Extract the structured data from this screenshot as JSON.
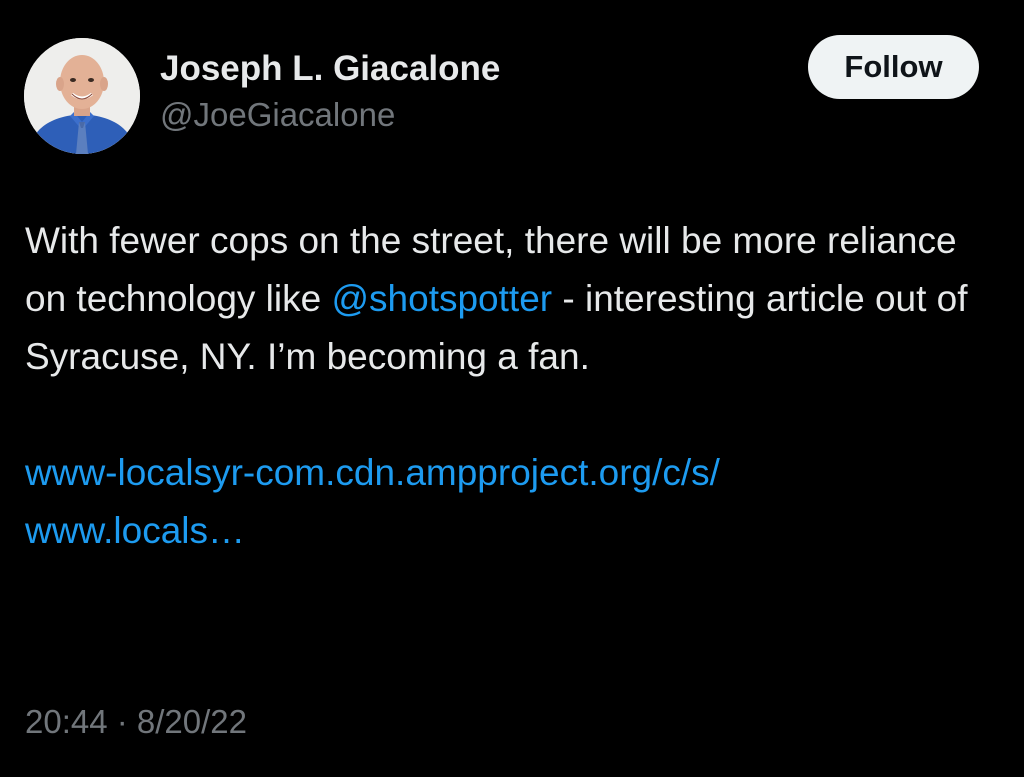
{
  "author": {
    "display_name": "Joseph L. Giacalone",
    "handle": "@JoeGiacalone",
    "avatar_icon": "profile-photo"
  },
  "follow_button": {
    "label": "Follow"
  },
  "tweet": {
    "text_part1": "With fewer cops on the street, there will be more reliance on technology like ",
    "mention": "@shotspotter",
    "text_part2": " - interesting article out of Syracuse, NY. I’m becoming a fan.",
    "url_line1": "www-localsyr-com.cdn.ampproject.org/c/s/",
    "url_line2": "www.locals…"
  },
  "meta": {
    "timestamp": "20:44 · 8/20/22"
  },
  "colors": {
    "background": "#000000",
    "text": "#e7e9ea",
    "secondary": "#71767b",
    "link": "#1d9bf0",
    "button_bg": "#eff3f4"
  }
}
